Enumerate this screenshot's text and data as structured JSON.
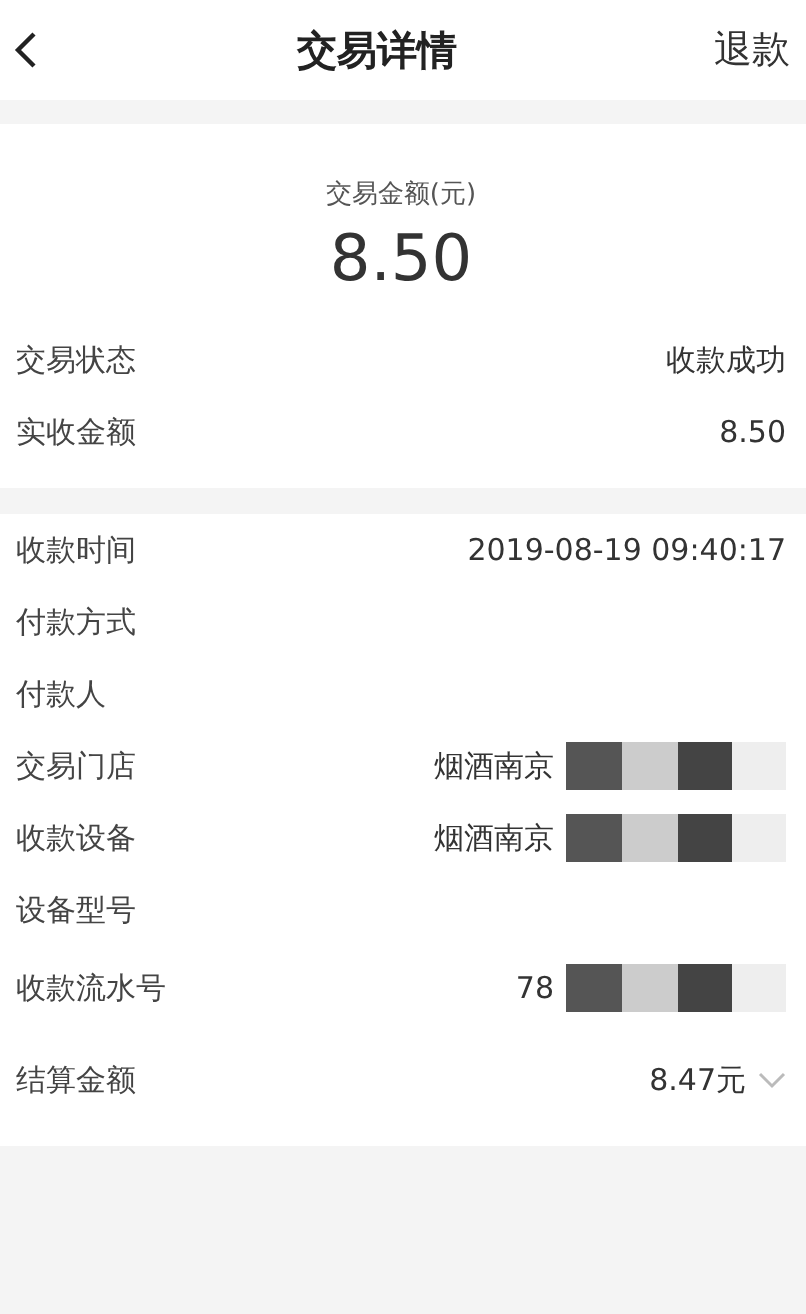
{
  "header": {
    "title": "交易详情",
    "action": "退款"
  },
  "summary": {
    "label": "交易金额(元)",
    "amount": "8.50"
  },
  "summary_rows": [
    {
      "label": "交易状态",
      "value": "收款成功"
    },
    {
      "label": "实收金额",
      "value": "8.50"
    }
  ],
  "detail_rows": [
    {
      "label": "收款时间",
      "value": "2019-08-19 09:40:17",
      "kind": "plain"
    },
    {
      "label": "付款方式",
      "kind": "plain"
    },
    {
      "label": "付款人",
      "kind": "plain"
    },
    {
      "label": "交易门店",
      "value": "烟酒南京",
      "kind": "redacted"
    },
    {
      "label": "收款设备",
      "value": "烟酒南京",
      "kind": "redacted"
    },
    {
      "label": "设备型号",
      "kind": "plain"
    },
    {
      "label": "收款流水号",
      "value": "78",
      "kind": "redacted"
    },
    {
      "label": "结算金额",
      "value": "8.47元",
      "kind": "expandable",
      "expanded": false
    }
  ]
}
